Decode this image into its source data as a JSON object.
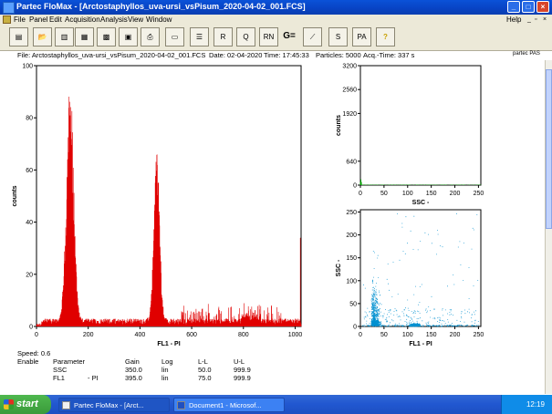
{
  "window": {
    "title": "Partec FloMax - [Arctostaphyllos_uva-ursi_vsPisum_2020-04-02_001.FCS]"
  },
  "menu": {
    "items": [
      "File",
      "Panel",
      "Edit",
      "Acquisition",
      "Analysis",
      "View",
      "Window"
    ],
    "help": "Help"
  },
  "toolbar": {
    "g_label": "G="
  },
  "fileinfo": {
    "file": "File: Arctostaphyllos_uva-ursi_vsPisum_2020-04-02_001.FCS",
    "date": "Date: 02-04-2020",
    "time": "Time: 17:45:33",
    "particles": "Particles: 5000",
    "acq": "Acq.-Time: 337 s",
    "brand": "partec PAS"
  },
  "status": {
    "speed": "Speed: 0.6",
    "headers": [
      "Enable",
      "Parameter",
      "Gain",
      "Log",
      "L-L",
      "U-L"
    ],
    "rows": [
      {
        "param": "SSC",
        "suffix": "",
        "gain": "350.0",
        "log": "lin",
        "ll": "50.0",
        "ul": "999.9"
      },
      {
        "param": "FL1",
        "suffix": "- PI",
        "gain": "395.0",
        "log": "lin",
        "ll": "75.0",
        "ul": "999.9"
      }
    ]
  },
  "taskbar": {
    "start": "start",
    "items": [
      "Partec FloMax - [Arct...",
      "Document1 - Microsof..."
    ],
    "clock": "12:19"
  },
  "chart_data": [
    {
      "type": "bar",
      "title": "",
      "xlabel": "FL1 - PI",
      "ylabel": "counts",
      "xlim": [
        0,
        1023
      ],
      "ylim": [
        0,
        100
      ],
      "xticks": [
        0,
        200,
        400,
        600,
        800,
        1000
      ],
      "yticks": [
        0,
        20,
        40,
        60,
        80,
        100
      ],
      "peaks": [
        {
          "x": 130,
          "height": 80
        },
        {
          "x": 465,
          "height": 58
        }
      ],
      "bar_color": "#e00000"
    },
    {
      "type": "bar",
      "title": "",
      "xlabel": "SSC -",
      "ylabel": "counts",
      "xlim": [
        0,
        255
      ],
      "ylim": [
        0,
        3200
      ],
      "xticks": [
        0,
        50,
        100,
        150,
        200,
        250
      ],
      "yticks": [
        0,
        640,
        1920,
        2560,
        3200
      ],
      "yticklabels": [
        "0",
        "640",
        "1920",
        "2560",
        "3200"
      ],
      "peaks": [
        {
          "x": 1,
          "height": 150
        }
      ],
      "bar_color": "#00a000"
    },
    {
      "type": "scatter",
      "title": "",
      "xlabel": "FL1 - PI",
      "ylabel": "SSC -",
      "xlim": [
        0,
        255
      ],
      "ylim": [
        0,
        255
      ],
      "xticks": [
        0,
        50,
        100,
        150,
        200,
        250
      ],
      "yticks": [
        0,
        50,
        100,
        150,
        200,
        250
      ],
      "point_color": "#0090d0",
      "clusters": [
        {
          "x": 25,
          "y": 5,
          "n": 900
        },
        {
          "x": 115,
          "y": 3,
          "n": 500
        }
      ]
    }
  ]
}
